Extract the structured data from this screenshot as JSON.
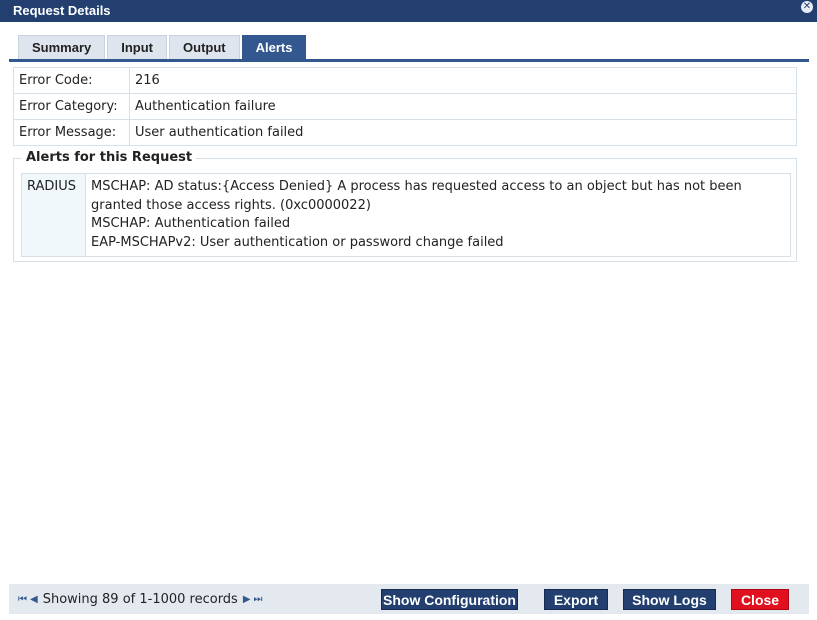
{
  "window": {
    "title": "Request Details"
  },
  "tabs": [
    "Summary",
    "Input",
    "Output",
    "Alerts"
  ],
  "active_tab": "Alerts",
  "fields": [
    {
      "label": "Error Code:",
      "value": "216"
    },
    {
      "label": "Error Category:",
      "value": "Authentication failure"
    },
    {
      "label": "Error Message:",
      "value": "User authentication failed"
    }
  ],
  "alerts_section": {
    "title": "Alerts for this Request",
    "source": "RADIUS",
    "messages": [
      "MSCHAP: AD status:{Access Denied} A process has requested access to an object but has not been",
      "granted those access rights. (0xc0000022)",
      "MSCHAP: Authentication failed",
      "EAP-MSCHAPv2: User authentication or password change failed"
    ]
  },
  "footer": {
    "records_text": "Showing 89 of 1-1000 records",
    "buttons": {
      "show_configuration": "Show Configuration",
      "export": "Export",
      "show_logs": "Show Logs",
      "close": "Close"
    }
  },
  "icons": {
    "close": "close-icon",
    "first": "first-page-icon",
    "prev": "prev-page-icon",
    "next": "next-page-icon",
    "last": "last-page-icon"
  },
  "colors": {
    "title_bar": "#223f70",
    "active_tab": "#33578f",
    "close_button": "#e0101e"
  }
}
